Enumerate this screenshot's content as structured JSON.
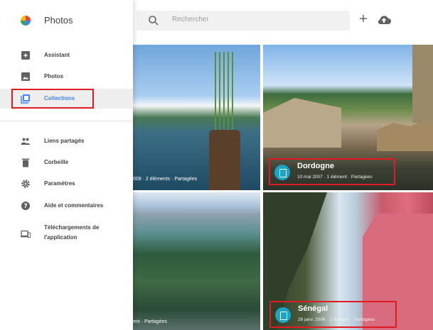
{
  "app": {
    "title": "Photos"
  },
  "search": {
    "placeholder": "Rechercher"
  },
  "toolbar": {
    "add_icon": "plus-icon",
    "upload_icon": "cloud-upload-icon"
  },
  "nav": {
    "items": [
      {
        "label": "Assistant",
        "icon": "assistant-icon",
        "active": false
      },
      {
        "label": "Photos",
        "icon": "photo-icon",
        "active": false
      },
      {
        "label": "Collections",
        "icon": "collections-icon",
        "active": true
      },
      {
        "label": "Liens partagés",
        "icon": "people-icon",
        "active": false
      },
      {
        "label": "Corbeille",
        "icon": "trash-icon",
        "active": false
      },
      {
        "label": "Paramètres",
        "icon": "gear-icon",
        "active": false
      },
      {
        "label": "Aide et commentaires",
        "icon": "help-icon",
        "active": false
      },
      {
        "label": "Téléchargements de l'application",
        "icon": "devices-icon",
        "active": false
      }
    ]
  },
  "tiles": [
    {
      "caption": "009 · 2 éléments · Partagées"
    },
    {
      "title": "Dordogne",
      "meta": "10 mai 2007 · 1 élément · Partagées"
    },
    {
      "caption": "ent · Partagées"
    },
    {
      "title": "Sénégal",
      "meta": "26 janv. 2006 · 1 élément · Partagées"
    }
  ],
  "colors": {
    "accent": "#4285f4",
    "highlight": "#e01b24",
    "collection_badge": "#1aa5c4"
  }
}
